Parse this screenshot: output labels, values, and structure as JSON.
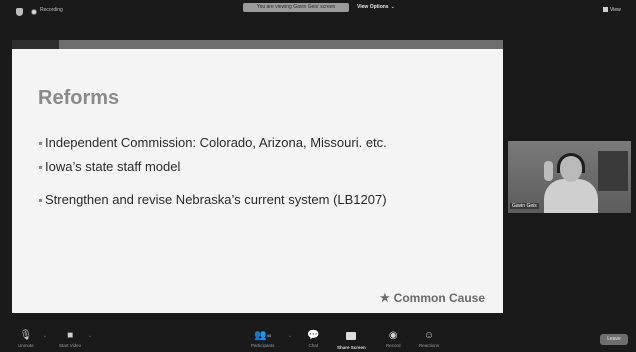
{
  "topbar": {
    "recording_label": "Recording",
    "viewing_text": "You are viewing Gavin Geis' screen",
    "view_options_label": "View Options",
    "view_label": "View"
  },
  "slide": {
    "title": "Reforms",
    "bullets": [
      "Independent Commission: Colorado, Arizona, Missouri. etc.",
      "Iowa’s state staff model",
      "Strengthen and revise Nebraska’s current system (LB1207)"
    ],
    "brand": "Common Cause"
  },
  "video": {
    "participant_name": "Gavin Geis"
  },
  "toolbar": {
    "unmute_label": "Unmute",
    "start_video_label": "Start Video",
    "participants_label": "Participants",
    "participants_count": "40",
    "chat_label": "Chat",
    "share_screen_label": "Share Screen",
    "record_label": "Record",
    "reactions_label": "Reactions",
    "leave_label": "Leave"
  }
}
